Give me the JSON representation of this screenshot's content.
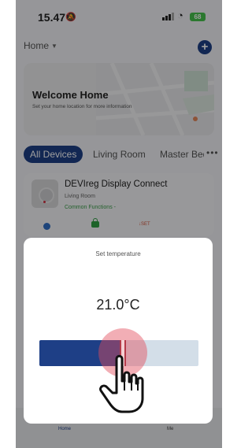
{
  "status_bar": {
    "time": "15.47",
    "battery": "68"
  },
  "header": {
    "home_label": "Home"
  },
  "welcome": {
    "title": "Welcome Home",
    "subtitle": "Set your home location for more information"
  },
  "tabs": [
    {
      "label": "All Devices",
      "active": true
    },
    {
      "label": "Living Room",
      "active": false
    },
    {
      "label": "Master Bedroom",
      "active": false
    }
  ],
  "device": {
    "name": "DEVIreg Display Connect",
    "room": "Living Room",
    "functions": "Common Functions -",
    "setback_label": "SET"
  },
  "modal": {
    "title": "Set temperature",
    "temperature": "21.0°C",
    "slider_fraction": 0.52
  },
  "bottom_nav": {
    "home": "Home",
    "me": "Me"
  },
  "colors": {
    "accent": "#1e3f86",
    "track": "#d3dee8",
    "battery": "#46c24c",
    "function_text": "#3a9d4a"
  },
  "icons": [
    "mute-bell-icon",
    "signal-icon",
    "wifi-icon",
    "battery-icon",
    "add-icon",
    "chevron-down-icon",
    "more-icon",
    "tap-hand-icon"
  ]
}
